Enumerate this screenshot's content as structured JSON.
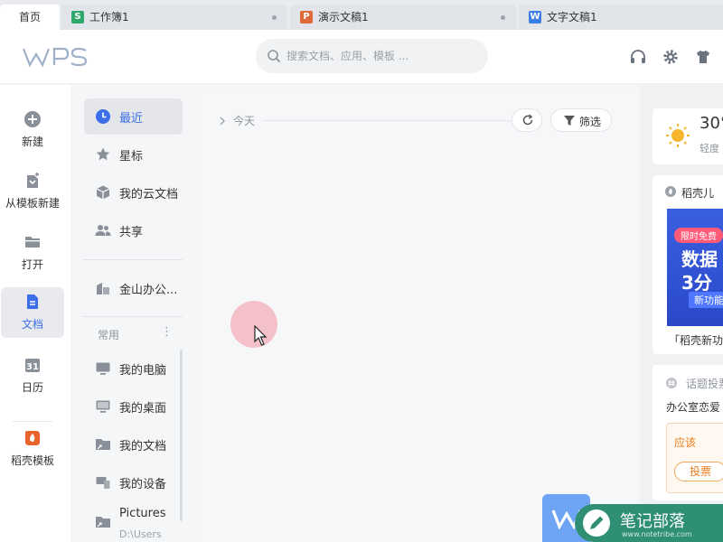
{
  "tabs": [
    {
      "label": "首页",
      "active": true
    },
    {
      "label": "工作簿1",
      "icon": "spreadsheet-icon",
      "icon_letter": "S",
      "color": "#2fa86c"
    },
    {
      "label": "演示文稿1",
      "icon": "presentation-icon",
      "icon_letter": "P",
      "color": "#e0693a"
    },
    {
      "label": "文字文稿1",
      "icon": "document-icon",
      "icon_letter": "W",
      "color": "#3c7ce6"
    }
  ],
  "header": {
    "logo": "WPS",
    "search_placeholder": "搜索文档、应用、模板 ...",
    "icons": [
      "headset-icon",
      "gear-icon",
      "shirt-icon"
    ]
  },
  "rail": {
    "items": [
      {
        "label": "新建",
        "icon": "plus-circle-icon"
      },
      {
        "label": "从模板新建",
        "icon": "template-icon"
      },
      {
        "label": "打开",
        "icon": "folder-icon"
      },
      {
        "label": "文档",
        "icon": "document-icon",
        "active": true
      },
      {
        "label": "日历",
        "icon": "calendar-icon",
        "icon_text": "31"
      },
      {
        "label": "稻壳模板",
        "icon": "docer-icon"
      }
    ]
  },
  "nav": {
    "items": [
      {
        "label": "最近",
        "icon": "clock-icon",
        "active": true
      },
      {
        "label": "星标",
        "icon": "star-icon"
      },
      {
        "label": "我的云文档",
        "icon": "cloud-box-icon"
      },
      {
        "label": "共享",
        "icon": "users-icon"
      }
    ],
    "org_item": {
      "label": "金山办公...",
      "icon": "building-icon"
    },
    "section_label": "常用",
    "more_glyph": "⋮",
    "common": [
      {
        "label": "我的电脑",
        "icon": "computer-icon"
      },
      {
        "label": "我的桌面",
        "icon": "desktop-icon"
      },
      {
        "label": "我的文档",
        "icon": "folder-shortcut-icon"
      },
      {
        "label": "我的设备",
        "icon": "device-icon"
      },
      {
        "label": "Pictures",
        "sub": "D:\\Users",
        "icon": "folder-shortcut-icon"
      }
    ]
  },
  "main": {
    "group_label": "今天",
    "filter_label": "筛选",
    "refresh_icon": "refresh-icon"
  },
  "right": {
    "weather": {
      "temp": "30°",
      "desc": "轻度"
    },
    "docer": {
      "title": "稻壳儿",
      "banner_tag": "限时免费",
      "banner_line1": "数据",
      "banner_line2": "3分",
      "banner_button": "新功能",
      "caption": "「稻壳新功"
    },
    "topic": {
      "title": "话题投票",
      "question": "办公室恋爱",
      "answer": "应该",
      "vote_button": "投票"
    }
  },
  "watermark": {
    "brand": "笔记部落",
    "url": "www.notetribe.com"
  },
  "colors": {
    "accent": "#3c6ee9",
    "docer": "#e8622c"
  }
}
